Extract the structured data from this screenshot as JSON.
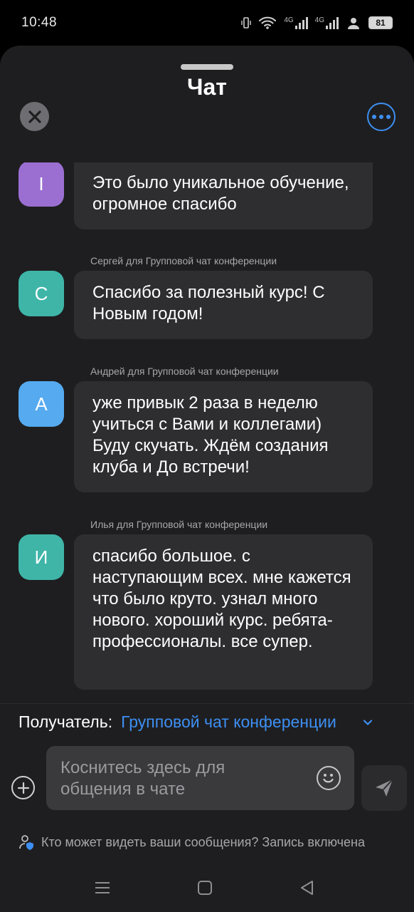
{
  "status_bar": {
    "time": "10:48",
    "network_label_1": "4G",
    "network_label_2": "4G",
    "battery": "81"
  },
  "header": {
    "title": "Чат",
    "close_icon": "close-icon",
    "more_icon": "more-options-icon"
  },
  "messages": [
    {
      "sender": "",
      "avatar_letter": "I",
      "avatar_color": "#9b6fd1",
      "text": "Это было уникальное обучение, огромное спасибо"
    },
    {
      "sender": "Сергей для Групповой чат конференции",
      "avatar_letter": "С",
      "avatar_color": "#3fb5a8",
      "text": "Спасибо за полезный курс! С Новым годом!"
    },
    {
      "sender": "Андрей для Групповой чат конференции",
      "avatar_letter": "А",
      "avatar_color": "#55aaf0",
      "text": "уже привык 2 раза в неделю учиться с Вами и коллегами) Буду скучать. Ждём создания клуба и До встречи!"
    },
    {
      "sender": "Илья для Групповой чат конференции",
      "avatar_letter": "И",
      "avatar_color": "#3fb5a8",
      "text": "спасибо большое. с наступающим всех. мне кажется что было круто. узнал много нового. хороший курс. ребята-профессионалы. все супер."
    }
  ],
  "composer": {
    "recipient_label": "Получатель:",
    "recipient_value": "Групповой чат конференции",
    "placeholder": "Коснитесь здесь для общения в чате",
    "privacy_text": "Кто может видеть ваши сообщения? Запись включена"
  },
  "colors": {
    "accent": "#3d8ff2",
    "sheet_bg": "#1e1e20",
    "bubble_bg": "#2e2e30"
  }
}
